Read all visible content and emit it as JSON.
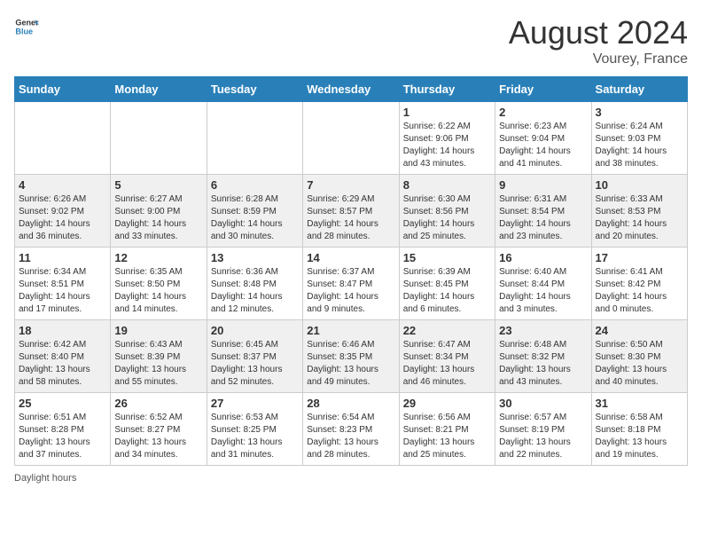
{
  "header": {
    "logo_general": "General",
    "logo_blue": "Blue",
    "month_title": "August 2024",
    "location": "Vourey, France"
  },
  "footer": {
    "note": "Daylight hours"
  },
  "weekdays": [
    "Sunday",
    "Monday",
    "Tuesday",
    "Wednesday",
    "Thursday",
    "Friday",
    "Saturday"
  ],
  "weeks": [
    [
      {
        "day": "",
        "info": ""
      },
      {
        "day": "",
        "info": ""
      },
      {
        "day": "",
        "info": ""
      },
      {
        "day": "",
        "info": ""
      },
      {
        "day": "1",
        "info": "Sunrise: 6:22 AM\nSunset: 9:06 PM\nDaylight: 14 hours and 43 minutes."
      },
      {
        "day": "2",
        "info": "Sunrise: 6:23 AM\nSunset: 9:04 PM\nDaylight: 14 hours and 41 minutes."
      },
      {
        "day": "3",
        "info": "Sunrise: 6:24 AM\nSunset: 9:03 PM\nDaylight: 14 hours and 38 minutes."
      }
    ],
    [
      {
        "day": "4",
        "info": "Sunrise: 6:26 AM\nSunset: 9:02 PM\nDaylight: 14 hours and 36 minutes."
      },
      {
        "day": "5",
        "info": "Sunrise: 6:27 AM\nSunset: 9:00 PM\nDaylight: 14 hours and 33 minutes."
      },
      {
        "day": "6",
        "info": "Sunrise: 6:28 AM\nSunset: 8:59 PM\nDaylight: 14 hours and 30 minutes."
      },
      {
        "day": "7",
        "info": "Sunrise: 6:29 AM\nSunset: 8:57 PM\nDaylight: 14 hours and 28 minutes."
      },
      {
        "day": "8",
        "info": "Sunrise: 6:30 AM\nSunset: 8:56 PM\nDaylight: 14 hours and 25 minutes."
      },
      {
        "day": "9",
        "info": "Sunrise: 6:31 AM\nSunset: 8:54 PM\nDaylight: 14 hours and 23 minutes."
      },
      {
        "day": "10",
        "info": "Sunrise: 6:33 AM\nSunset: 8:53 PM\nDaylight: 14 hours and 20 minutes."
      }
    ],
    [
      {
        "day": "11",
        "info": "Sunrise: 6:34 AM\nSunset: 8:51 PM\nDaylight: 14 hours and 17 minutes."
      },
      {
        "day": "12",
        "info": "Sunrise: 6:35 AM\nSunset: 8:50 PM\nDaylight: 14 hours and 14 minutes."
      },
      {
        "day": "13",
        "info": "Sunrise: 6:36 AM\nSunset: 8:48 PM\nDaylight: 14 hours and 12 minutes."
      },
      {
        "day": "14",
        "info": "Sunrise: 6:37 AM\nSunset: 8:47 PM\nDaylight: 14 hours and 9 minutes."
      },
      {
        "day": "15",
        "info": "Sunrise: 6:39 AM\nSunset: 8:45 PM\nDaylight: 14 hours and 6 minutes."
      },
      {
        "day": "16",
        "info": "Sunrise: 6:40 AM\nSunset: 8:44 PM\nDaylight: 14 hours and 3 minutes."
      },
      {
        "day": "17",
        "info": "Sunrise: 6:41 AM\nSunset: 8:42 PM\nDaylight: 14 hours and 0 minutes."
      }
    ],
    [
      {
        "day": "18",
        "info": "Sunrise: 6:42 AM\nSunset: 8:40 PM\nDaylight: 13 hours and 58 minutes."
      },
      {
        "day": "19",
        "info": "Sunrise: 6:43 AM\nSunset: 8:39 PM\nDaylight: 13 hours and 55 minutes."
      },
      {
        "day": "20",
        "info": "Sunrise: 6:45 AM\nSunset: 8:37 PM\nDaylight: 13 hours and 52 minutes."
      },
      {
        "day": "21",
        "info": "Sunrise: 6:46 AM\nSunset: 8:35 PM\nDaylight: 13 hours and 49 minutes."
      },
      {
        "day": "22",
        "info": "Sunrise: 6:47 AM\nSunset: 8:34 PM\nDaylight: 13 hours and 46 minutes."
      },
      {
        "day": "23",
        "info": "Sunrise: 6:48 AM\nSunset: 8:32 PM\nDaylight: 13 hours and 43 minutes."
      },
      {
        "day": "24",
        "info": "Sunrise: 6:50 AM\nSunset: 8:30 PM\nDaylight: 13 hours and 40 minutes."
      }
    ],
    [
      {
        "day": "25",
        "info": "Sunrise: 6:51 AM\nSunset: 8:28 PM\nDaylight: 13 hours and 37 minutes."
      },
      {
        "day": "26",
        "info": "Sunrise: 6:52 AM\nSunset: 8:27 PM\nDaylight: 13 hours and 34 minutes."
      },
      {
        "day": "27",
        "info": "Sunrise: 6:53 AM\nSunset: 8:25 PM\nDaylight: 13 hours and 31 minutes."
      },
      {
        "day": "28",
        "info": "Sunrise: 6:54 AM\nSunset: 8:23 PM\nDaylight: 13 hours and 28 minutes."
      },
      {
        "day": "29",
        "info": "Sunrise: 6:56 AM\nSunset: 8:21 PM\nDaylight: 13 hours and 25 minutes."
      },
      {
        "day": "30",
        "info": "Sunrise: 6:57 AM\nSunset: 8:19 PM\nDaylight: 13 hours and 22 minutes."
      },
      {
        "day": "31",
        "info": "Sunrise: 6:58 AM\nSunset: 8:18 PM\nDaylight: 13 hours and 19 minutes."
      }
    ]
  ]
}
